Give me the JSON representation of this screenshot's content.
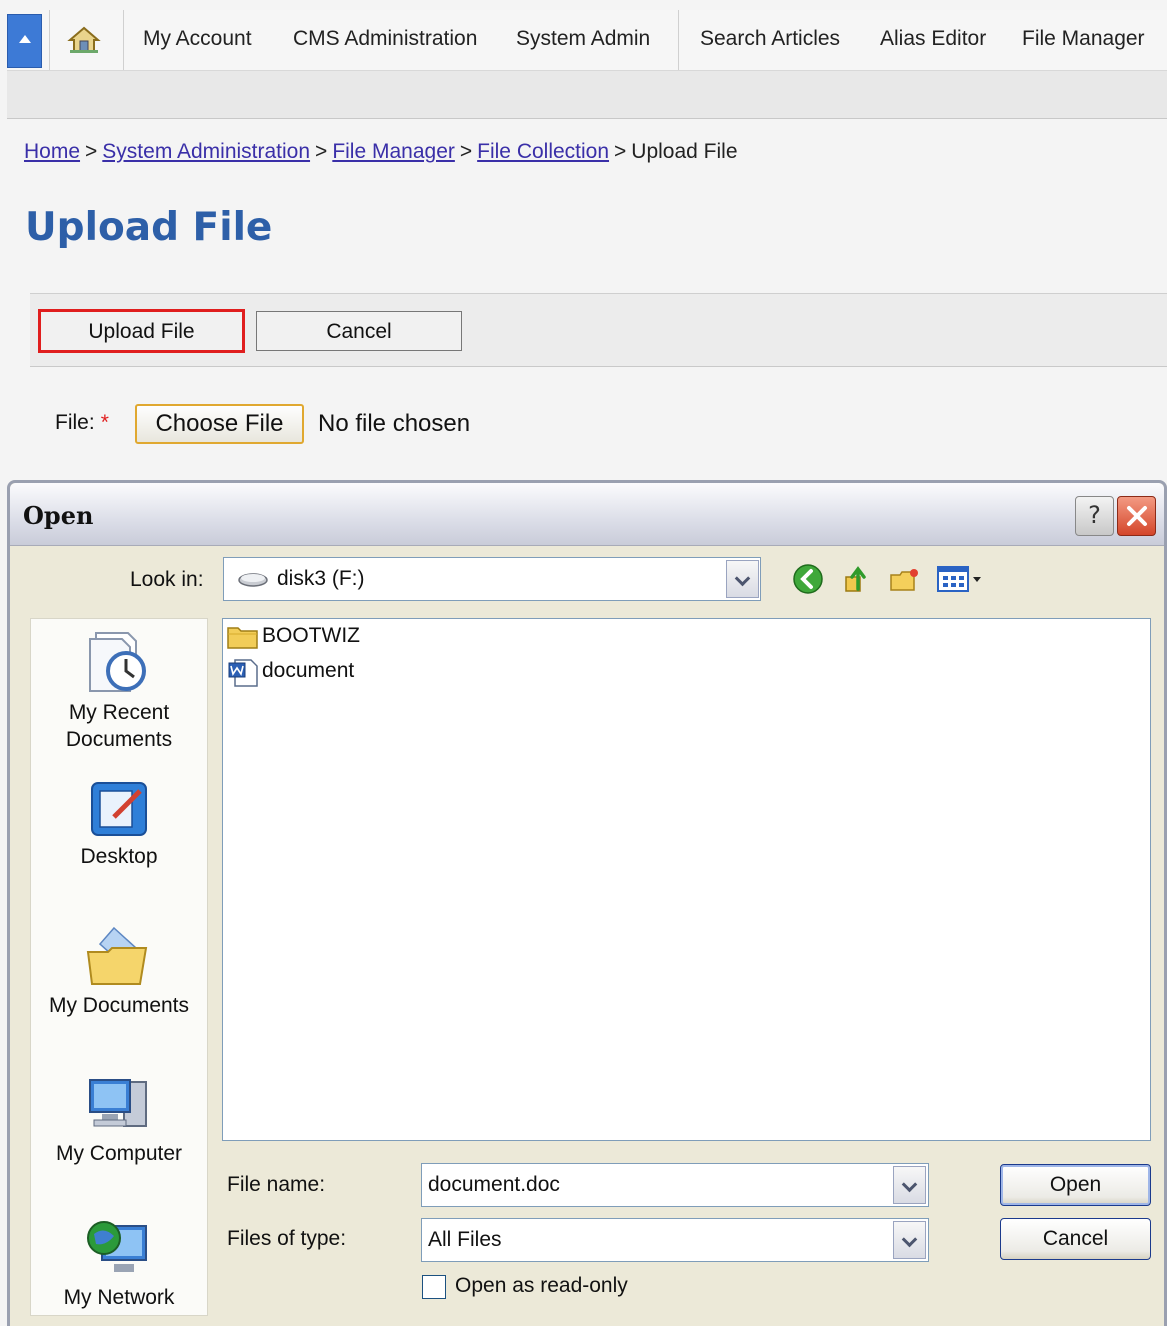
{
  "nav": {
    "items": [
      "My Account",
      "CMS Administration",
      "System Admin",
      "Search Articles",
      "Alias Editor",
      "File Manager"
    ]
  },
  "breadcrumb": {
    "links": [
      "Home",
      "System Administration",
      "File Manager",
      "File Collection"
    ],
    "current": "Upload File",
    "separator": ">"
  },
  "page": {
    "title": "Upload File",
    "toolbar": {
      "upload_label": "Upload File",
      "cancel_label": "Cancel"
    },
    "file_field": {
      "label": "File:",
      "required_mark": "*",
      "choose_label": "Choose File",
      "status": "No file chosen"
    }
  },
  "dialog": {
    "title": "Open",
    "help_label": "?",
    "look_in": {
      "label": "Look in:",
      "value": "disk3 (F:)"
    },
    "places": [
      "My Recent Documents",
      "Desktop",
      "My Documents",
      "My Computer",
      "My Network"
    ],
    "files": [
      {
        "name": "BOOTWIZ",
        "icon": "folder-icon"
      },
      {
        "name": "document",
        "icon": "word-document-icon"
      }
    ],
    "file_name": {
      "label": "File name:",
      "value": "document.doc"
    },
    "file_type": {
      "label": "Files of type:",
      "value": "All Files"
    },
    "read_only_label": "Open as read-only",
    "open_label": "Open",
    "cancel_label": "Cancel"
  },
  "colors": {
    "title_blue": "#2d5fa8",
    "highlight_red": "#e01e1e",
    "link": "#3a2fa8"
  }
}
